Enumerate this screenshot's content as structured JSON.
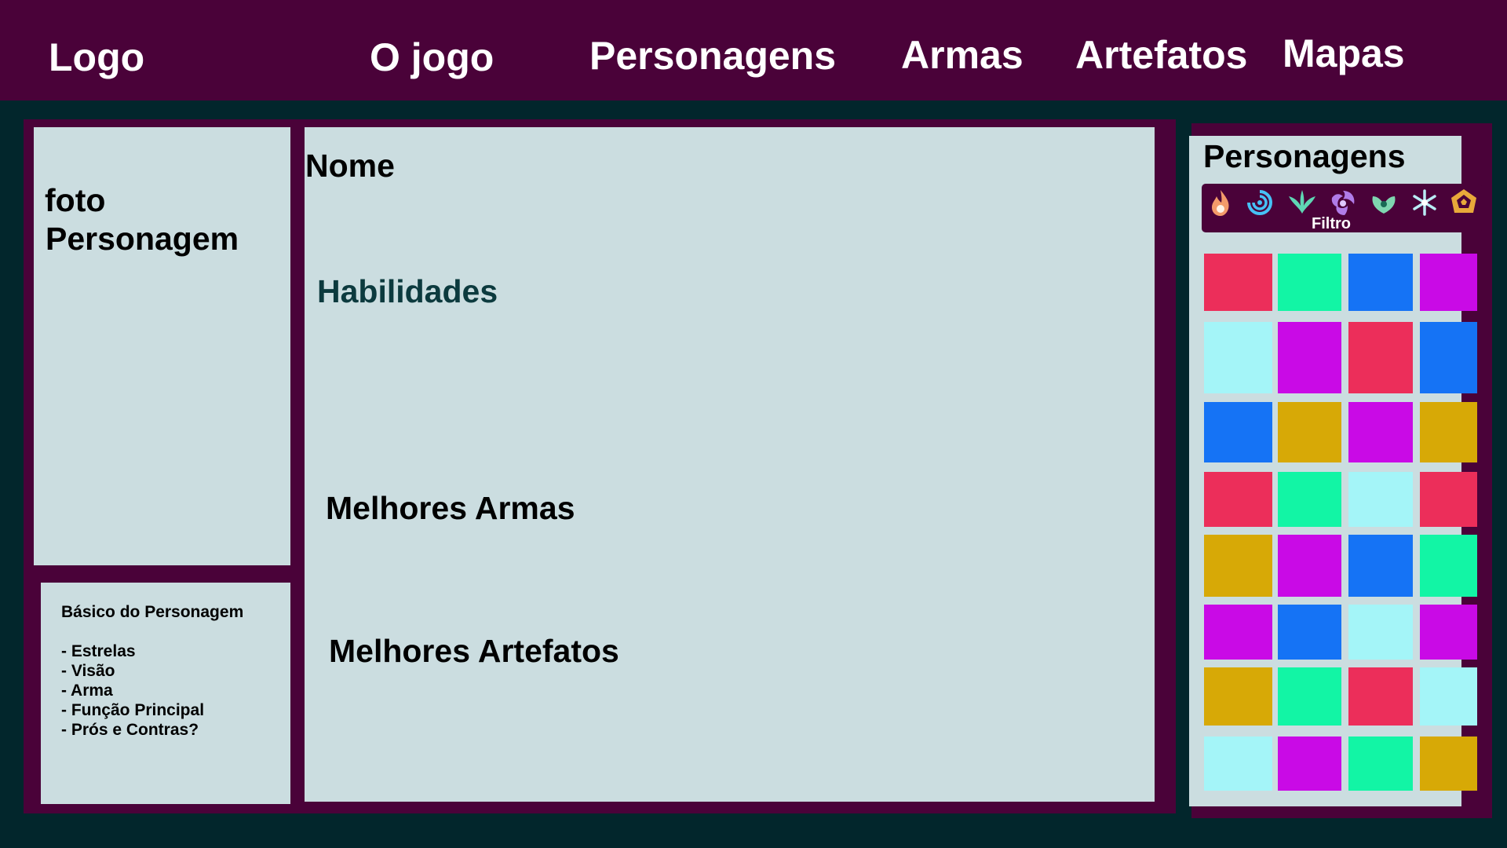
{
  "nav": {
    "logo": "Logo",
    "items": [
      "O jogo",
      "Personagens",
      "Armas",
      "Artefatos",
      "Mapas"
    ]
  },
  "photo": {
    "label_line1": "foto",
    "label_line2": "Personagem"
  },
  "details": {
    "name": "Nome",
    "abilities": "Habilidades",
    "best_weapons": "Melhores Armas",
    "best_artifacts": "Melhores Artefatos"
  },
  "basic": {
    "title": "Básico do Personagem",
    "items": [
      "- Estrelas",
      "- Visão",
      "- Arma",
      "- Função Principal",
      "- Prós e Contras?"
    ]
  },
  "sidebar": {
    "title": "Personagens",
    "filter_label": "Filtro",
    "filter_icons": [
      "pyro-icon",
      "hydro-icon",
      "anemo-icon",
      "electro-icon",
      "dendro-icon",
      "cryo-icon",
      "geo-icon"
    ]
  },
  "colors": {
    "red": "#ec2e5a",
    "green": "#12f5a5",
    "blue": "#1573f5",
    "purple": "#c90ae6",
    "cyan": "#a4f5f8",
    "gold": "#d7a906"
  },
  "character_grid": [
    [
      "red",
      "green",
      "blue",
      "purple"
    ],
    [
      "cyan",
      "purple",
      "red",
      "blue"
    ],
    [
      "blue",
      "gold",
      "purple",
      "gold"
    ],
    [
      "red",
      "green",
      "cyan",
      "red"
    ],
    [
      "gold",
      "purple",
      "blue",
      "green"
    ],
    [
      "purple",
      "blue",
      "cyan",
      "purple"
    ],
    [
      "gold",
      "green",
      "red",
      "cyan"
    ],
    [
      "cyan",
      "purple",
      "green",
      "gold"
    ]
  ]
}
